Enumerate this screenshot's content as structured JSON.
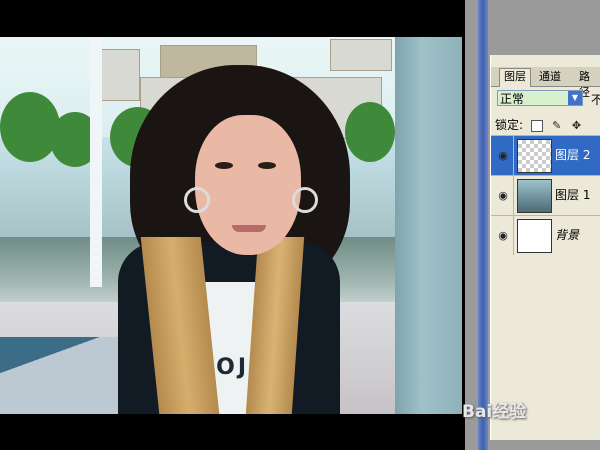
{
  "layers_panel": {
    "tabs": [
      {
        "label": "图层"
      },
      {
        "label": "通道"
      },
      {
        "label": "路径"
      }
    ],
    "blend_mode": "正常",
    "opacity_label": "不",
    "lock_label": "锁定:",
    "lock_icons": [
      "lock-transparent-icon",
      "lock-brush-icon",
      "lock-move-icon",
      "lock-all-icon"
    ],
    "layers": [
      {
        "name": "图层 2",
        "selected": true,
        "thumb": "transparent"
      },
      {
        "name": "图层 1",
        "selected": false,
        "thumb": "photo"
      },
      {
        "name": "背景",
        "selected": false,
        "thumb": "white"
      }
    ]
  },
  "photo": {
    "shirt_text": "JOJ"
  },
  "watermark": {
    "text": "Bai经验"
  }
}
